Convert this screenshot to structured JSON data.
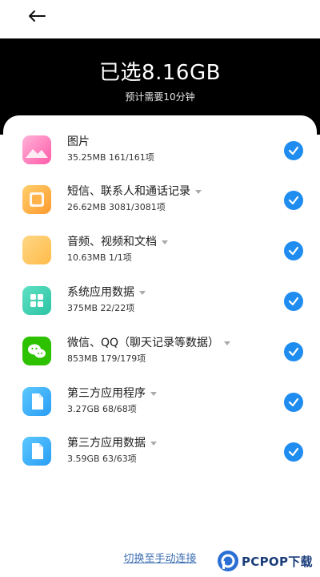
{
  "summary": {
    "title": "已选8.16GB",
    "subtitle": "预计需要10分钟"
  },
  "accent_color": "#1f8cf0",
  "items": [
    {
      "title": "图片",
      "meta": "35.25MB  161/161项",
      "icon": "photos-icon",
      "has_dropdown": false,
      "checked": true
    },
    {
      "title": "短信、联系人和通话记录",
      "meta": "26.62MB  3081/3081项",
      "icon": "messages-icon",
      "has_dropdown": true,
      "checked": true
    },
    {
      "title": "音频、视频和文档",
      "meta": "10.63MB  1/1项",
      "icon": "folder-icon",
      "has_dropdown": true,
      "checked": true
    },
    {
      "title": "系统应用数据",
      "meta": "375MB  22/22项",
      "icon": "system-apps-icon",
      "has_dropdown": true,
      "checked": true
    },
    {
      "title": "微信、QQ（聊天记录等数据）",
      "meta": "853MB  179/179项",
      "icon": "wechat-icon",
      "has_dropdown": true,
      "checked": true
    },
    {
      "title": "第三方应用程序",
      "meta": "3.27GB  68/68项",
      "icon": "third-party-app-icon",
      "has_dropdown": true,
      "checked": true
    },
    {
      "title": "第三方应用数据",
      "meta": "3.59GB  63/63项",
      "icon": "third-party-data-icon",
      "has_dropdown": true,
      "checked": true
    }
  ],
  "footer": {
    "link": "切换至手动连接"
  },
  "watermark": {
    "text": "PCPOP下载"
  }
}
